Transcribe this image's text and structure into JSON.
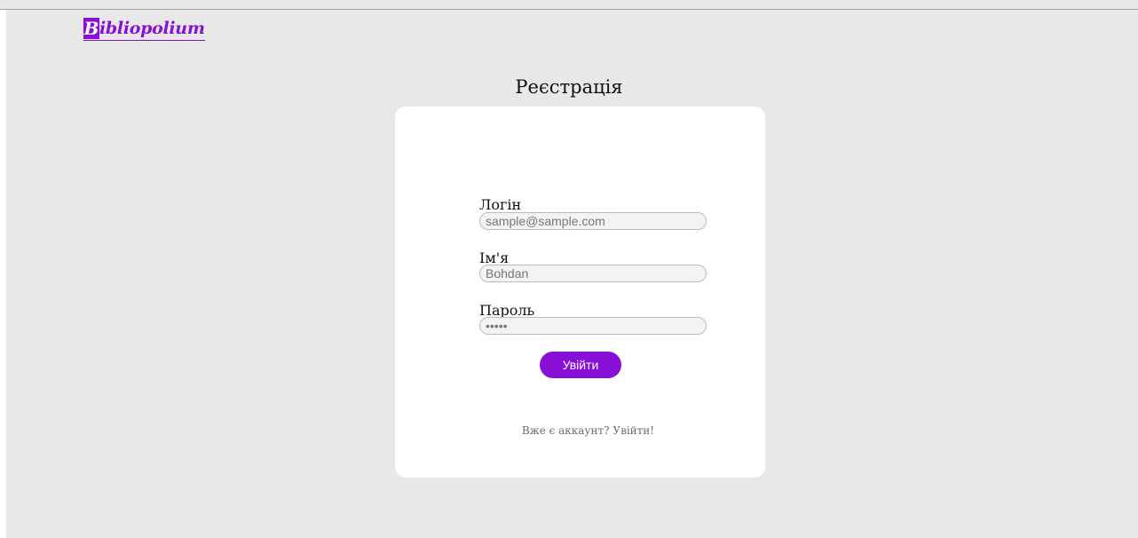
{
  "header": {
    "logo": {
      "mark": "B",
      "text": "ibliopolium"
    }
  },
  "page": {
    "title": "Реєстрація"
  },
  "form": {
    "login": {
      "label": "Логін",
      "placeholder": "sample@sample.com",
      "value": ""
    },
    "name": {
      "label": "Ім'я",
      "placeholder": "Bohdan",
      "value": ""
    },
    "password": {
      "label": "Пароль",
      "placeholder": "",
      "value": "•••••"
    },
    "submit_label": "Увійти",
    "footer_text": "Вже є аккаунт? Увійти!"
  },
  "colors": {
    "accent": "#8a0fd6",
    "background": "#e8e8e8",
    "card": "#ffffff"
  },
  "icons": [
    "logo-mark"
  ]
}
